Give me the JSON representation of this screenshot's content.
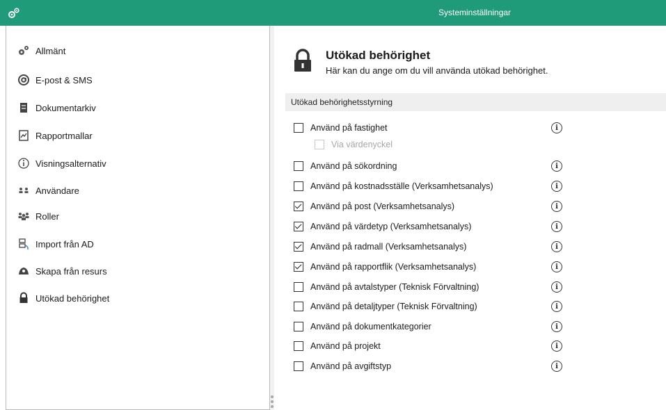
{
  "window": {
    "title": "Systeminställningar",
    "accent": "#1f9b7a"
  },
  "sidebar": {
    "items": [
      {
        "label": "Allmänt",
        "icon": "gears-icon"
      },
      {
        "label": "E-post & SMS",
        "icon": "at-icon"
      },
      {
        "label": "Dokumentarkiv",
        "icon": "archive-icon"
      },
      {
        "label": "Rapportmallar",
        "icon": "report-template-icon"
      },
      {
        "label": "Visningsalternativ",
        "icon": "info-circle-icon"
      },
      {
        "label": "Användare",
        "icon": "users-icon"
      },
      {
        "label": "Roller",
        "icon": "roles-icon"
      },
      {
        "label": "Import från AD",
        "icon": "import-ad-icon"
      },
      {
        "label": "Skapa från resurs",
        "icon": "resource-icon"
      },
      {
        "label": "Utökad behörighet",
        "icon": "lock-icon"
      }
    ]
  },
  "content": {
    "title": "Utökad behörighet",
    "description": "Här kan du ange om du vill använda utökad behörighet.",
    "group_label": "Utökad behörighetsstyrning",
    "options": [
      {
        "label": "Använd på fastighet",
        "checked": false
      },
      {
        "label": "Via värdenyckel",
        "checked": false,
        "disabled": true
      },
      {
        "label": "Använd på sökordning",
        "checked": false
      },
      {
        "label": "Använd på kostnadsställe (Verksamhetsanalys)",
        "checked": false
      },
      {
        "label": "Använd på post (Verksamhetsanalys)",
        "checked": true
      },
      {
        "label": "Använd på värdetyp (Verksamhetsanalys)",
        "checked": true
      },
      {
        "label": "Använd på radmall (Verksamhetsanalys)",
        "checked": true
      },
      {
        "label": "Använd på rapportflik (Verksamhetsanalys)",
        "checked": true
      },
      {
        "label": "Använd på avtalstyper (Teknisk Förvaltning)",
        "checked": false
      },
      {
        "label": "Använd på detaljtyper (Teknisk Förvaltning)",
        "checked": false
      },
      {
        "label": "Använd på dokumentkategorier",
        "checked": false
      },
      {
        "label": "Använd på projekt",
        "checked": false
      },
      {
        "label": "Använd på avgiftstyp",
        "checked": false
      }
    ],
    "info_glyph": "i"
  }
}
